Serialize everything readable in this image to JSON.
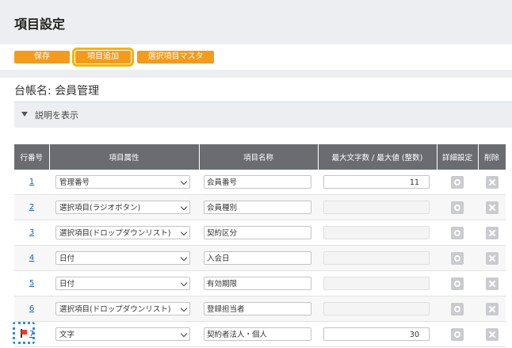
{
  "page": {
    "title": "項目設定"
  },
  "toolbar": {
    "save_label": "保存",
    "add_label": "項目追加",
    "master_label": "選択項目マスタ"
  },
  "ledger": {
    "label": "台帳名: 会員管理"
  },
  "explain": {
    "label": "説明を表示"
  },
  "table": {
    "headers": [
      "行番号",
      "項目属性",
      "項目名称",
      "最大文字数 / 最大値 (整数)",
      "詳細設定",
      "削除"
    ],
    "rows": [
      {
        "no": "1",
        "type": "管理番号",
        "name": "会員番号",
        "max": "11",
        "enabled": true
      },
      {
        "no": "2",
        "type": "選択項目(ラジオボタン)",
        "name": "会員種別",
        "max": "",
        "enabled": false
      },
      {
        "no": "3",
        "type": "選択項目(ドロップダウンリスト)",
        "name": "契約区分",
        "max": "",
        "enabled": false
      },
      {
        "no": "4",
        "type": "日付",
        "name": "入会日",
        "max": "",
        "enabled": false
      },
      {
        "no": "5",
        "type": "日付",
        "name": "有効期限",
        "max": "",
        "enabled": false
      },
      {
        "no": "6",
        "type": "選択項目(ドロップダウンリスト)",
        "name": "登録担当者",
        "max": "",
        "enabled": false
      },
      {
        "no": "7",
        "type": "文字",
        "name": "契約者法人・個人",
        "max": "30",
        "enabled": true
      }
    ]
  },
  "colors": {
    "accent": "#f29b1d",
    "header_bg": "#6a6c72",
    "link": "#1a5fb0",
    "highlight": "#f2b400"
  }
}
